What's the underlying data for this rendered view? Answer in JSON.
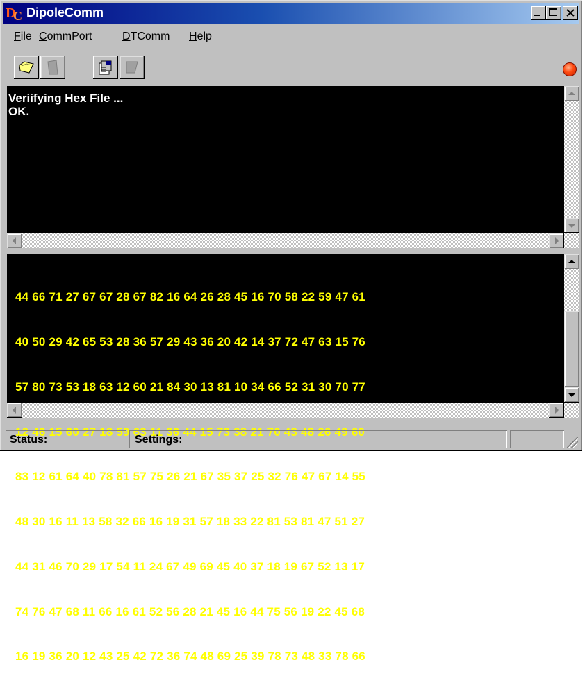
{
  "window": {
    "title": "DipoleComm"
  },
  "menu": {
    "file": {
      "label": "File",
      "u": "F",
      "rest": "ile"
    },
    "commport": {
      "label": "CommPort",
      "u": "C",
      "rest": "ommPort"
    },
    "dtcomm": {
      "label": "DTComm",
      "u": "D",
      "rest": "TComm"
    },
    "help": {
      "label": "Help",
      "u": "H",
      "rest": "elp"
    }
  },
  "toolbar": {
    "buttons": [
      "open-icon",
      "save-icon",
      "properties-icon",
      "disabled-icon"
    ],
    "status_led_color": "#ff4a10"
  },
  "log": {
    "lines": [
      "Veriifying Hex File ...",
      "OK."
    ]
  },
  "hex": {
    "rows": [
      "44 66 71 27 67 67 28 67 82 16 64 26 28 45 16 70 58 22 59 47 61",
      "40 50 29 42 65 53 28 36 57 29 43 36 20 42 14 37 72 47 63 15 76",
      "57 80 73 53 18 63 12 60 21 84 30 13 81 10 34 66 52 31 30 70 77",
      "12 46 15 60 27 18 59 63 11 36 44 15 73 38 21 70 43 48 26 49 60",
      "83 12 61 64 40 78 81 57 75 26 21 67 35 37 25 32 76 47 67 14 55",
      "48 30 16 11 13 58 32 66 16 19 31 57 18 33 22 81 53 81 47 51 27",
      "44 31 46 70 29 17 54 11 24 67 49 69 45 40 37 18 19 67 52 13 17",
      "74 76 47 68 11 66 16 61 52 56 28 21 45 16 44 75 56 19 22 45 68",
      "16 19 36 20 12 43 25 42 72 36 74 48 69 25 39 78 73 48 33 78 66"
    ],
    "text_color": "#ffff00"
  },
  "statusbar": {
    "status_label": "Status:",
    "settings_label": "Settings:"
  }
}
